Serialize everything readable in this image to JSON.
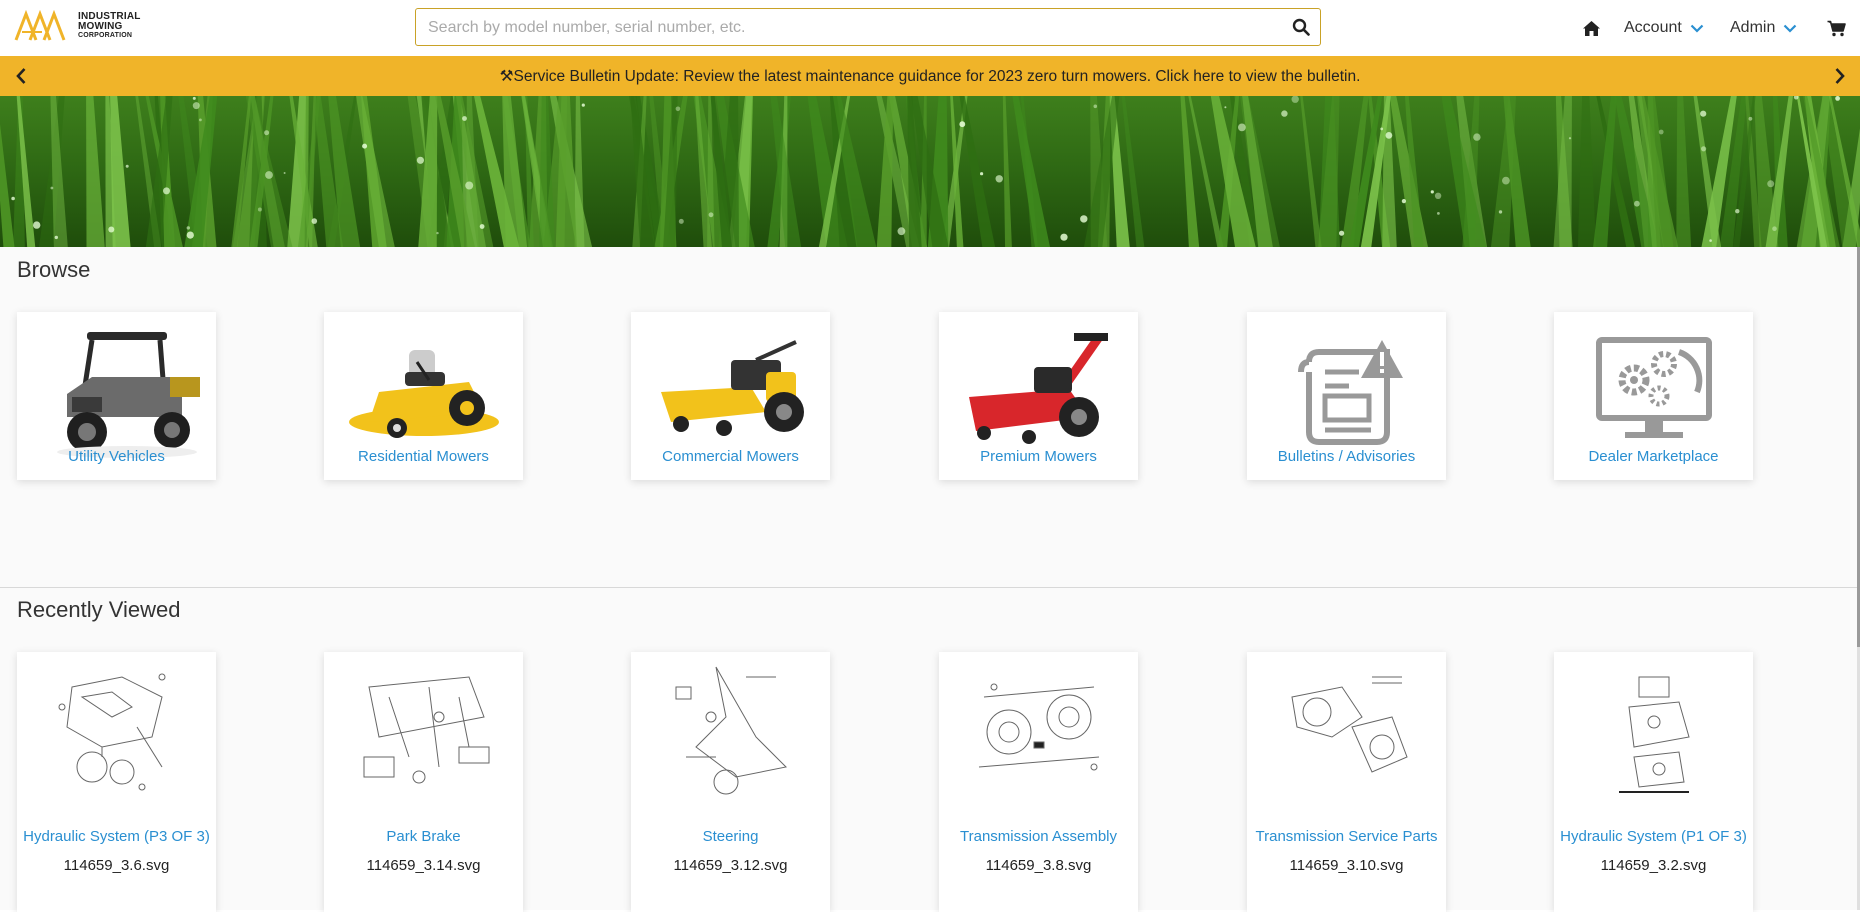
{
  "header": {
    "logo": {
      "line1": "INDUSTRIAL",
      "line2": "MOWING",
      "line3": "CORPORATION"
    },
    "search_placeholder": "Search by model number, serial number, etc.",
    "nav": {
      "account_label": "Account",
      "admin_label": "Admin"
    },
    "icons": {
      "home": "home-icon",
      "cart": "cart-icon",
      "search": "search-icon"
    }
  },
  "bulletin": {
    "text": "⚒Service Bulletin Update: Review the latest maintenance guidance for 2023 zero turn mowers. Click here to view the bulletin."
  },
  "browse": {
    "title": "Browse",
    "items": [
      {
        "label": "Utility Vehicles",
        "icon": "utility-vehicle-image"
      },
      {
        "label": "Residential Mowers",
        "icon": "residential-mower-image"
      },
      {
        "label": "Commercial Mowers",
        "icon": "commercial-mower-image"
      },
      {
        "label": "Premium Mowers",
        "icon": "premium-mower-image"
      },
      {
        "label": "Bulletins / Advisories",
        "icon": "bulletin-document-icon"
      },
      {
        "label": "Dealer Marketplace",
        "icon": "monitor-gears-icon"
      }
    ]
  },
  "recent": {
    "title": "Recently Viewed",
    "items": [
      {
        "label": "Hydraulic System (P3 OF 3)",
        "file": "114659_3.6.svg"
      },
      {
        "label": "Park Brake",
        "file": "114659_3.14.svg"
      },
      {
        "label": "Steering",
        "file": "114659_3.12.svg"
      },
      {
        "label": "Transmission Assembly",
        "file": "114659_3.8.svg"
      },
      {
        "label": "Transmission Service Parts",
        "file": "114659_3.10.svg"
      },
      {
        "label": "Hydraulic System (P1 OF 3)",
        "file": "114659_3.2.svg"
      }
    ]
  },
  "colors": {
    "accent": "#f0b429",
    "link": "#2a8fd1",
    "mower_yellow": "#f2c21b",
    "mower_red": "#d8262b"
  }
}
